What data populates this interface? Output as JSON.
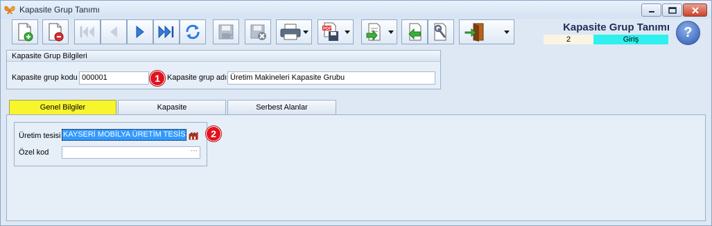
{
  "window": {
    "title": "Kapasite Grup Tanımı"
  },
  "toolbar": {
    "buttons": [
      "new-record",
      "delete-record",
      "first",
      "previous",
      "next",
      "last",
      "refresh",
      "save",
      "cancel",
      "print",
      "pdf-export",
      "import",
      "back",
      "settings",
      "exit"
    ]
  },
  "header": {
    "form_title": "Kapasite Grup Tanımı",
    "counter": "2",
    "mode": "Giriş",
    "help_glyph": "?"
  },
  "group": {
    "title": "Kapasite Grup Bilgileri",
    "code_label": "Kapasite grup kodu",
    "code_value": "000001",
    "name_label": "Kapasite grup adı",
    "name_value": "Üretim Makineleri Kapasite Grubu"
  },
  "badges": [
    "1",
    "2"
  ],
  "tabs": [
    {
      "label": "Genel Bilgiler",
      "active": true
    },
    {
      "label": "Kapasite",
      "active": false
    },
    {
      "label": "Serbest Alanlar",
      "active": false
    }
  ],
  "general": {
    "facility_label": "Üretim tesisi",
    "facility_value": "KAYSERİ MOBİLYA ÜRETİM TESİSİ",
    "special_code_label": "Özel kod",
    "special_code_value": "",
    "ellipsis": "···"
  },
  "colors": {
    "active_tab": "#f7f52e",
    "mode_bg": "#2ef0ee",
    "badge": "#e0141e",
    "selection": "#3399ff"
  }
}
